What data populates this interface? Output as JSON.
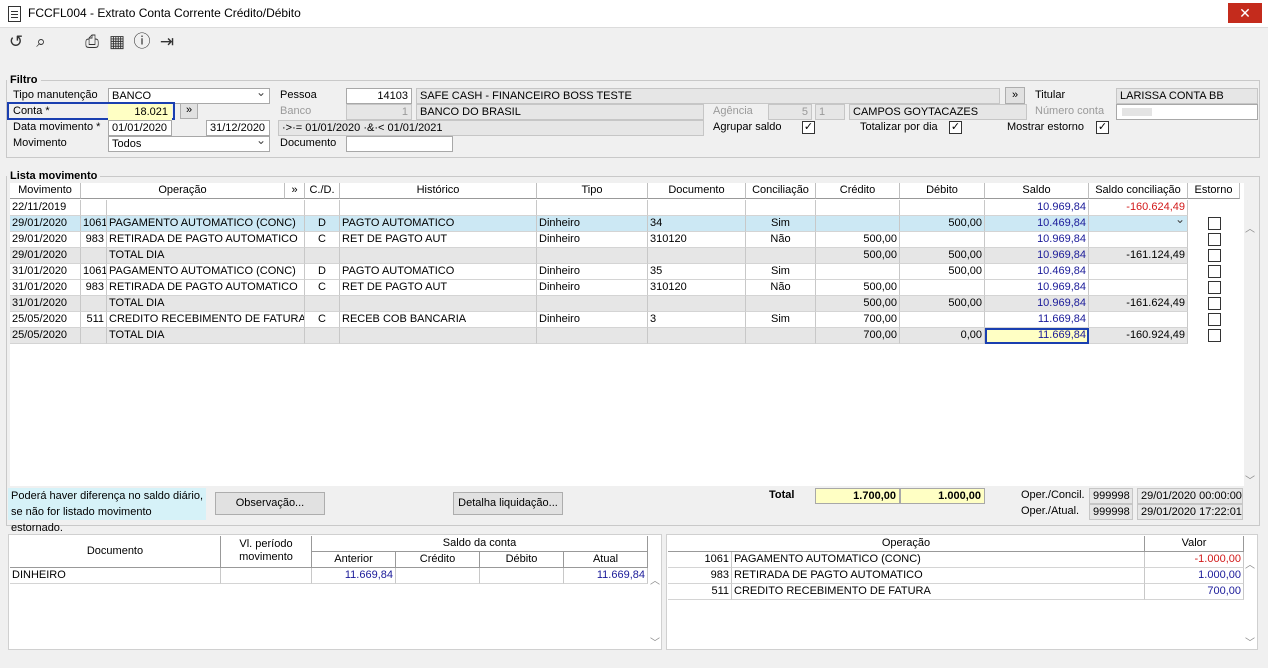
{
  "window": {
    "title": "FCCFL004 - Extrato Conta Corrente Crédito/Débito",
    "close": "✕"
  },
  "toolbar": [
    "undo-icon",
    "search-icon",
    "print-icon",
    "calendar-icon",
    "help-icon",
    "exit-icon"
  ],
  "filter": {
    "legend": "Filtro",
    "tipo_label": "Tipo manutenção",
    "tipo_value": "BANCO",
    "conta_label": "Conta *",
    "conta_value": "18.021",
    "data_label": "Data movimento *",
    "data_from": "01/01/2020",
    "data_to": "31/12/2020",
    "data_expr": "·>·= 01/01/2020 ·&·< 01/01/2021",
    "movimento_label": "Movimento",
    "movimento_value": "Todos",
    "pessoa_label": "Pessoa",
    "pessoa_code": "14103",
    "pessoa_name": "SAFE CASH - FINANCEIRO BOSS TESTE",
    "banco_label": "Banco",
    "banco_code": "1",
    "banco_name": "BANCO DO BRASIL",
    "agencia_label": "Agência",
    "agencia_code": "5",
    "agencia_digit": "1",
    "agencia_name": "CAMPOS GOYTACAZES",
    "documento_label": "Documento",
    "documento_value": "",
    "agrupar_label": "Agrupar saldo",
    "totalizar_label": "Totalizar por dia",
    "estorno_label": "Mostrar estorno",
    "titular_label": "Titular",
    "titular_value": "LARISSA CONTA BB",
    "numero_label": "Número conta",
    "numero_value": "",
    "more": "»"
  },
  "lista": {
    "legend": "Lista movimento",
    "headers": [
      "Movimento",
      "Operação",
      "»",
      "C./D.",
      "Histórico",
      "Tipo",
      "Documento",
      "Conciliação",
      "Crédito",
      "Débito",
      "Saldo",
      "Saldo conciliação",
      "Estorno"
    ],
    "rows": [
      {
        "mov": "22/11/2019",
        "op_code": "",
        "op": "",
        "cd": "",
        "hist": "",
        "tipo": "",
        "doc": "",
        "conc": "",
        "cred": "",
        "deb": "",
        "saldo": "10.969,84",
        "saldo_conc": "-160.624,49",
        "kind": "opening",
        "estorno": false
      },
      {
        "mov": "29/01/2020",
        "op_code": "1061",
        "op": "PAGAMENTO AUTOMATICO (CONC)",
        "cd": "D",
        "hist": "PAGTO AUTOMATICO",
        "tipo": "Dinheiro",
        "doc": "34",
        "conc": "Sim",
        "cred": "",
        "deb": "500,00",
        "saldo": "10.469,84",
        "saldo_conc": "",
        "kind": "sel",
        "estorno": true
      },
      {
        "mov": "29/01/2020",
        "op_code": "983",
        "op": "RETIRADA DE PAGTO AUTOMATICO",
        "cd": "C",
        "hist": "RET  DE PAGTO AUT",
        "tipo": "Dinheiro",
        "doc": "310120",
        "conc": "Não",
        "cred": "500,00",
        "deb": "",
        "saldo": "10.969,84",
        "saldo_conc": "",
        "kind": "normal",
        "estorno": true
      },
      {
        "mov": "29/01/2020",
        "op_code": "",
        "op": "TOTAL DIA",
        "cd": "",
        "hist": "",
        "tipo": "",
        "doc": "",
        "conc": "",
        "cred": "500,00",
        "deb": "500,00",
        "saldo": "10.969,84",
        "saldo_conc": "-161.124,49",
        "kind": "total",
        "estorno": true
      },
      {
        "mov": "31/01/2020",
        "op_code": "1061",
        "op": "PAGAMENTO AUTOMATICO (CONC)",
        "cd": "D",
        "hist": "PAGTO AUTOMATICO",
        "tipo": "Dinheiro",
        "doc": "35",
        "conc": "Sim",
        "cred": "",
        "deb": "500,00",
        "saldo": "10.469,84",
        "saldo_conc": "",
        "kind": "normal",
        "estorno": true
      },
      {
        "mov": "31/01/2020",
        "op_code": "983",
        "op": "RETIRADA DE PAGTO AUTOMATICO",
        "cd": "C",
        "hist": "RET  DE PAGTO AUT",
        "tipo": "Dinheiro",
        "doc": "310120",
        "conc": "Não",
        "cred": "500,00",
        "deb": "",
        "saldo": "10.969,84",
        "saldo_conc": "",
        "kind": "normal",
        "estorno": true
      },
      {
        "mov": "31/01/2020",
        "op_code": "",
        "op": "TOTAL DIA",
        "cd": "",
        "hist": "",
        "tipo": "",
        "doc": "",
        "conc": "",
        "cred": "500,00",
        "deb": "500,00",
        "saldo": "10.969,84",
        "saldo_conc": "-161.624,49",
        "kind": "total",
        "estorno": true
      },
      {
        "mov": "25/05/2020",
        "op_code": "511",
        "op": "CREDITO RECEBIMENTO DE FATURA",
        "cd": "C",
        "hist": "RECEB  COB  BANCARIA",
        "tipo": "Dinheiro",
        "doc": "3",
        "conc": "Sim",
        "cred": "700,00",
        "deb": "",
        "saldo": "11.669,84",
        "saldo_conc": "",
        "kind": "normal",
        "estorno": true
      },
      {
        "mov": "25/05/2020",
        "op_code": "",
        "op": "TOTAL DIA",
        "cd": "",
        "hist": "",
        "tipo": "",
        "doc": "",
        "conc": "",
        "cred": "700,00",
        "deb": "0,00",
        "saldo": "11.669,84",
        "saldo_conc": "-160.924,49",
        "kind": "total",
        "estorno": true
      }
    ],
    "note_line1": "Poderá haver diferença no saldo diário,",
    "note_line2": "se não for listado movimento estornado.",
    "obs_button": "Observação...",
    "detalha_button": "Detalha liquidação...",
    "total_label": "Total",
    "total_cred": "1.700,00",
    "total_deb": "1.000,00",
    "oper_concil_label": "Oper./Concil.",
    "oper_concil_code": "999998",
    "oper_concil_date": "29/01/2020 00:00:00",
    "oper_atual_label": "Oper./Atual.",
    "oper_atual_code": "999998",
    "oper_atual_date": "29/01/2020 17:22:01"
  },
  "saldo_table": {
    "h_documento": "Documento",
    "h_vl": "Vl. período movimento",
    "h_saldo": "Saldo da conta",
    "h_anterior": "Anterior",
    "h_credito": "Crédito",
    "h_debito": "Débito",
    "h_atual": "Atual",
    "rows": [
      {
        "doc": "DINHEIRO",
        "vl": "",
        "anterior": "11.669,84",
        "credito": "",
        "debito": "",
        "atual": "11.669,84"
      }
    ]
  },
  "operacao_table": {
    "h_operacao": "Operação",
    "h_valor": "Valor",
    "rows": [
      {
        "code": "1061",
        "name": "PAGAMENTO AUTOMATICO (CONC)",
        "valor": "-1.000,00",
        "neg": true
      },
      {
        "code": "983",
        "name": "RETIRADA DE PAGTO AUTOMATICO",
        "valor": "1.000,00",
        "neg": false
      },
      {
        "code": "511",
        "name": "CREDITO RECEBIMENTO DE FATURA",
        "valor": "700,00",
        "neg": false
      }
    ]
  }
}
